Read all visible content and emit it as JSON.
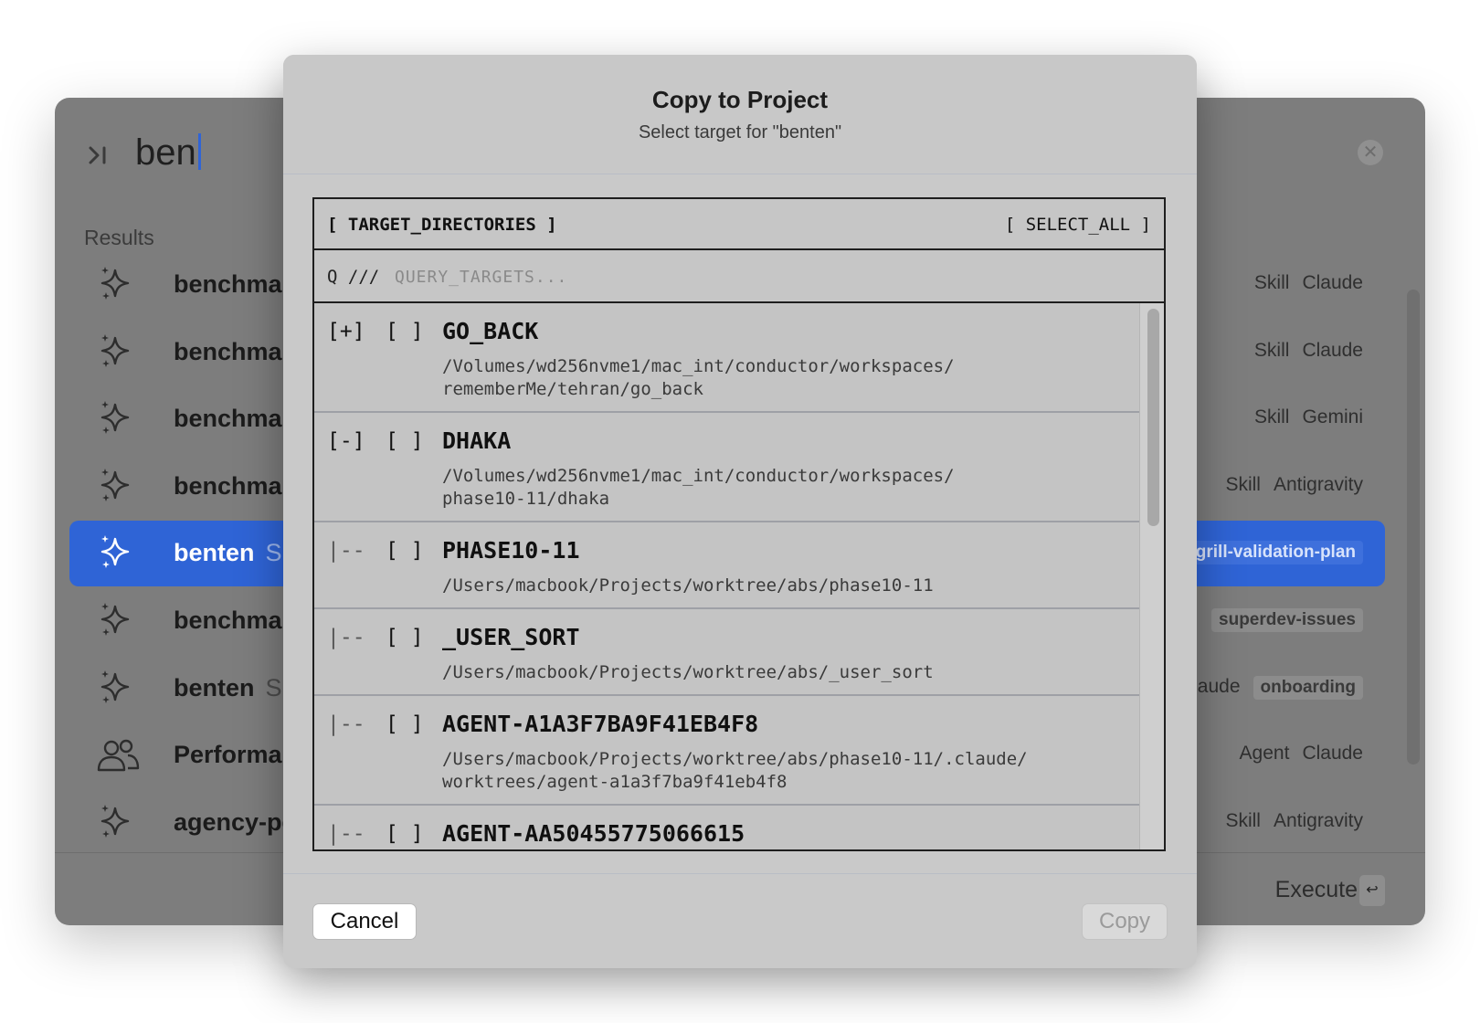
{
  "launcher": {
    "query": "ben",
    "results_label": "Results",
    "rows": [
      {
        "title": "benchmark",
        "sub": "",
        "meta": [
          "Skill",
          "Claude"
        ],
        "tag": "",
        "icon": "sparkle-icon"
      },
      {
        "title": "benchmark",
        "sub": "",
        "meta": [
          "Skill",
          "Claude"
        ],
        "tag": "",
        "icon": "sparkle-icon"
      },
      {
        "title": "benchmark",
        "sub": "",
        "meta": [
          "Skill",
          "Gemini"
        ],
        "tag": "",
        "icon": "sparkle-icon"
      },
      {
        "title": "benchmark",
        "sub": "",
        "meta": [
          "Skill",
          "Antigravity"
        ],
        "tag": "",
        "icon": "sparkle-icon"
      },
      {
        "title": "benten",
        "sub": "Skil",
        "meta": [],
        "tag": "grill-validation-plan",
        "icon": "sparkle-icon",
        "selected": true
      },
      {
        "title": "benchmark",
        "sub": "",
        "meta": [],
        "tag": "superdev-issues",
        "icon": "sparkle-icon"
      },
      {
        "title": "benten",
        "sub": "Skil",
        "meta": [
          "aude"
        ],
        "tag": "onboarding",
        "icon": "sparkle-icon"
      },
      {
        "title": "Performanc",
        "sub": "",
        "meta": [
          "Agent",
          "Claude"
        ],
        "tag": "",
        "icon": "people-icon"
      },
      {
        "title": "agency-per",
        "sub": "",
        "meta": [
          "Skill",
          "Antigravity"
        ],
        "tag": "",
        "icon": "sparkle-icon"
      }
    ],
    "execute_label": "Execute",
    "enter_key": "↩"
  },
  "modal": {
    "title": "Copy to Project",
    "subtitle": "Select target for \"benten\"",
    "panel_title": "[ TARGET_DIRECTORIES ]",
    "select_all": "[ SELECT_ALL ]",
    "query_prefix": "Q ///",
    "query_placeholder": "QUERY_TARGETS...",
    "query_value": "",
    "items": [
      {
        "marker": "[+]",
        "check": "[ ]",
        "name": "GO_BACK",
        "path_lines": [
          "/Volumes/wd256nvme1/mac_int/conductor/workspaces/",
          "rememberMe/tehran/go_back"
        ]
      },
      {
        "marker": "[-]",
        "check": "[ ]",
        "name": "DHAKA",
        "path_lines": [
          "/Volumes/wd256nvme1/mac_int/conductor/workspaces/",
          "phase10-11/dhaka"
        ]
      },
      {
        "marker": "|--",
        "check": "[ ]",
        "name": "PHASE10-11",
        "path_lines": [
          "/Users/macbook/Projects/worktree/abs/phase10-11"
        ]
      },
      {
        "marker": "|--",
        "check": "[ ]",
        "name": "_USER_SORT",
        "path_lines": [
          "/Users/macbook/Projects/worktree/abs/_user_sort"
        ]
      },
      {
        "marker": "|--",
        "check": "[ ]",
        "name": "AGENT-A1A3F7BA9F41EB4F8",
        "path_lines": [
          "/Users/macbook/Projects/worktree/abs/phase10-11/.claude/",
          "worktrees/agent-a1a3f7ba9f41eb4f8"
        ]
      },
      {
        "marker": "|--",
        "check": "[ ]",
        "name": "AGENT-AA50455775066615",
        "path_lines": [
          ""
        ]
      }
    ],
    "cancel_label": "Cancel",
    "copy_label": "Copy"
  }
}
